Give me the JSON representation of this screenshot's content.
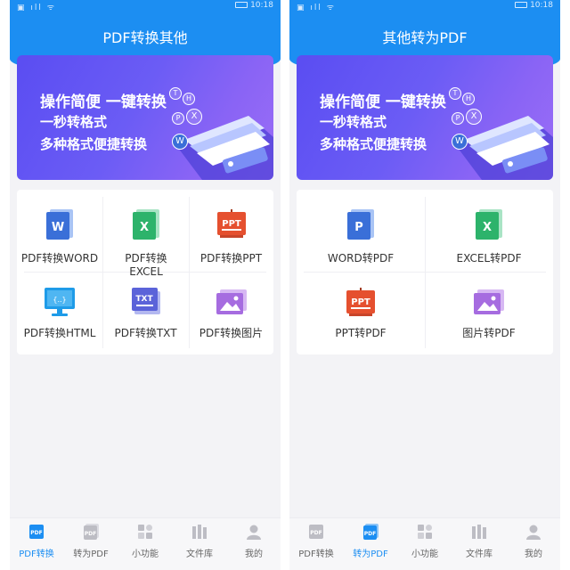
{
  "status_bar": {
    "time": "10:18"
  },
  "left_screen": {
    "title": "PDF转换其他",
    "banner": {
      "line1": "操作简便  一键转换",
      "line2": "一秒转格式",
      "line3": "多种格式便捷转换",
      "bubbles": [
        "T",
        "H",
        "P",
        "X",
        "W"
      ]
    },
    "tiles": [
      {
        "label": "PDF转换WORD",
        "icon": "word-doc-icon",
        "glyph": "W",
        "color": "#3a6fd8"
      },
      {
        "label": "PDF转换EXCEL",
        "icon": "excel-doc-icon",
        "glyph": "X",
        "color": "#2db36b"
      },
      {
        "label": "PDF转换PPT",
        "icon": "ppt-board-icon",
        "glyph": "PPT",
        "color": "#e5502f"
      },
      {
        "label": "PDF转换HTML",
        "icon": "html-monitor-icon",
        "glyph": "{..}",
        "color": "#1e9be8"
      },
      {
        "label": "PDF转换TXT",
        "icon": "txt-doc-icon",
        "glyph": "TXT",
        "color": "#5b63d9"
      },
      {
        "label": "PDF转换图片",
        "icon": "image-icon",
        "glyph": "",
        "color": "#a66ce0"
      }
    ],
    "active_tab": 0
  },
  "right_screen": {
    "title": "其他转为PDF",
    "banner": {
      "line1": "操作简便  一键转换",
      "line2": "一秒转格式",
      "line3": "多种格式便捷转换",
      "bubbles": [
        "T",
        "H",
        "P",
        "X",
        "W"
      ]
    },
    "tiles": [
      {
        "label": "WORD转PDF",
        "icon": "word-to-pdf-icon",
        "glyph": "P",
        "color": "#3a6fd8"
      },
      {
        "label": "EXCEL转PDF",
        "icon": "excel-to-pdf-icon",
        "glyph": "X",
        "color": "#2db36b"
      },
      {
        "label": "PPT转PDF",
        "icon": "ppt-to-pdf-icon",
        "glyph": "PPT",
        "color": "#e5502f"
      },
      {
        "label": "图片转PDF",
        "icon": "image-to-pdf-icon",
        "glyph": "",
        "color": "#a66ce0"
      }
    ],
    "active_tab": 1
  },
  "tabs": [
    {
      "label": "PDF转换",
      "icon": "pdf-convert-icon",
      "glyph": "PDF"
    },
    {
      "label": "转为PDF",
      "icon": "to-pdf-icon",
      "glyph": "PDF"
    },
    {
      "label": "小功能",
      "icon": "tools-grid-icon",
      "glyph": ""
    },
    {
      "label": "文件库",
      "icon": "file-library-icon",
      "glyph": ""
    },
    {
      "label": "我的",
      "icon": "profile-icon",
      "glyph": ""
    }
  ],
  "colors": {
    "primary": "#1c8ef2",
    "banner_start": "#5a4df2",
    "banner_end": "#9b6ef6",
    "tab_inactive": "#bdbdc4"
  }
}
